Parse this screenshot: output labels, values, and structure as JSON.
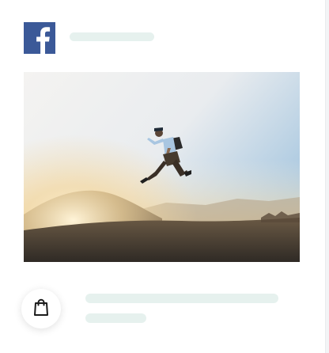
{
  "post": {
    "network_icon": "facebook-logo-icon",
    "author_placeholder": "",
    "image_subject": "",
    "caption_placeholder": ""
  },
  "actions": {
    "shop_icon": "shopping-bag-icon"
  },
  "colors": {
    "facebook_blue": "#3b5998",
    "skeleton": "#e6f1ee",
    "card_bg": "#ffffff"
  }
}
